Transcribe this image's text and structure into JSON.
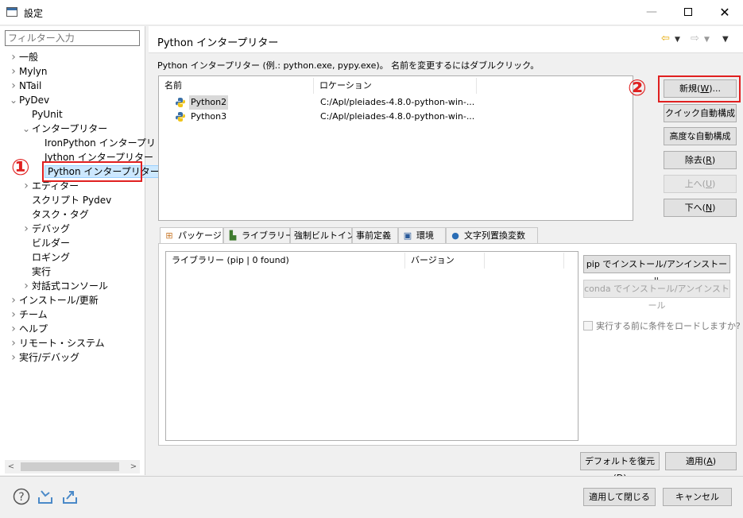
{
  "window": {
    "title": "設定"
  },
  "filter": {
    "placeholder": "フィルター入力"
  },
  "tree": [
    {
      "label": "一般",
      "chevron": ">",
      "indent": 0
    },
    {
      "label": "Mylyn",
      "chevron": ">",
      "indent": 0
    },
    {
      "label": "NTail",
      "chevron": ">",
      "indent": 0
    },
    {
      "label": "PyDev",
      "chevron": "v",
      "indent": 0
    },
    {
      "label": "PyUnit",
      "chevron": "",
      "indent": 1
    },
    {
      "label": "インタープリター",
      "chevron": "v",
      "indent": 1
    },
    {
      "label": "IronPython インタープリ",
      "chevron": "",
      "indent": 2
    },
    {
      "label": "Jython インタープリター",
      "chevron": "",
      "indent": 2
    },
    {
      "label": "Python インタープリター",
      "chevron": "",
      "indent": 2,
      "selected": true
    },
    {
      "label": "エディター",
      "chevron": ">",
      "indent": 1
    },
    {
      "label": "スクリプト Pydev",
      "chevron": "",
      "indent": 1
    },
    {
      "label": "タスク・タグ",
      "chevron": "",
      "indent": 1
    },
    {
      "label": "デバッグ",
      "chevron": ">",
      "indent": 1
    },
    {
      "label": "ビルダー",
      "chevron": "",
      "indent": 1
    },
    {
      "label": "ロギング",
      "chevron": "",
      "indent": 1
    },
    {
      "label": "実行",
      "chevron": "",
      "indent": 1
    },
    {
      "label": "対話式コンソール",
      "chevron": ">",
      "indent": 1
    },
    {
      "label": "インストール/更新",
      "chevron": ">",
      "indent": 0
    },
    {
      "label": "チーム",
      "chevron": ">",
      "indent": 0
    },
    {
      "label": "ヘルプ",
      "chevron": ">",
      "indent": 0
    },
    {
      "label": "リモート・システム",
      "chevron": ">",
      "indent": 0
    },
    {
      "label": "実行/デバッグ",
      "chevron": ">",
      "indent": 0
    }
  ],
  "page": {
    "title": "Python インタープリター",
    "description": "Python インタープリター (例.: python.exe, pypy.exe)。 名前を変更するにはダブルクリック。"
  },
  "interpreters": {
    "columns": [
      "名前",
      "ロケーション"
    ],
    "rows": [
      {
        "name": "Python2",
        "location": "C:/Apl/pleiades-4.8.0-python-win-...",
        "selected": true
      },
      {
        "name": "Python3",
        "location": "C:/Apl/pleiades-4.8.0-python-win-..."
      }
    ]
  },
  "side_buttons": {
    "new": {
      "label": "新規(",
      "mnemonic": "W",
      "suffix": ")..."
    },
    "quick_auto": {
      "label": "クイック自動構成"
    },
    "advanced_auto": {
      "label": "高度な自動構成"
    },
    "remove": {
      "label": "除去(",
      "mnemonic": "R",
      "suffix": ")"
    },
    "up": {
      "label": "上へ(",
      "mnemonic": "U",
      "suffix": ")"
    },
    "down": {
      "label": "下へ(",
      "mnemonic": "N",
      "suffix": ")"
    }
  },
  "annotations": {
    "one": "①",
    "two": "②"
  },
  "tabs": [
    {
      "label": "パッケージ",
      "icon": "package-icon",
      "active": true
    },
    {
      "label": "ライブラリー",
      "icon": "library-icon"
    },
    {
      "label": "強制ビルトイン",
      "icon": ""
    },
    {
      "label": "事前定義",
      "icon": ""
    },
    {
      "label": "環境",
      "icon": "environment-icon"
    },
    {
      "label": "文字列置換変数",
      "icon": "variables-icon"
    }
  ],
  "libraries": {
    "columns": [
      "ライブラリー (pip | 0 found)",
      "バージョン"
    ]
  },
  "pip_button": "pip でインストール/アンインストール",
  "conda_button": "conda でインストール/アンインストール",
  "load_conditions": "実行する前に条件をロードしますか?",
  "bottom_buttons": {
    "restore": {
      "label": "デフォルトを復元(",
      "mnemonic": "D",
      "suffix": ")"
    },
    "apply": {
      "label": "適用(",
      "mnemonic": "A",
      "suffix": ")"
    }
  },
  "footer": {
    "apply_close": "適用して閉じる",
    "cancel": "キャンセル",
    "icons": [
      "help-icon",
      "import-icon",
      "export-icon"
    ]
  },
  "colors": {
    "annotation": "#e02020",
    "selection": "#cce8ff"
  }
}
